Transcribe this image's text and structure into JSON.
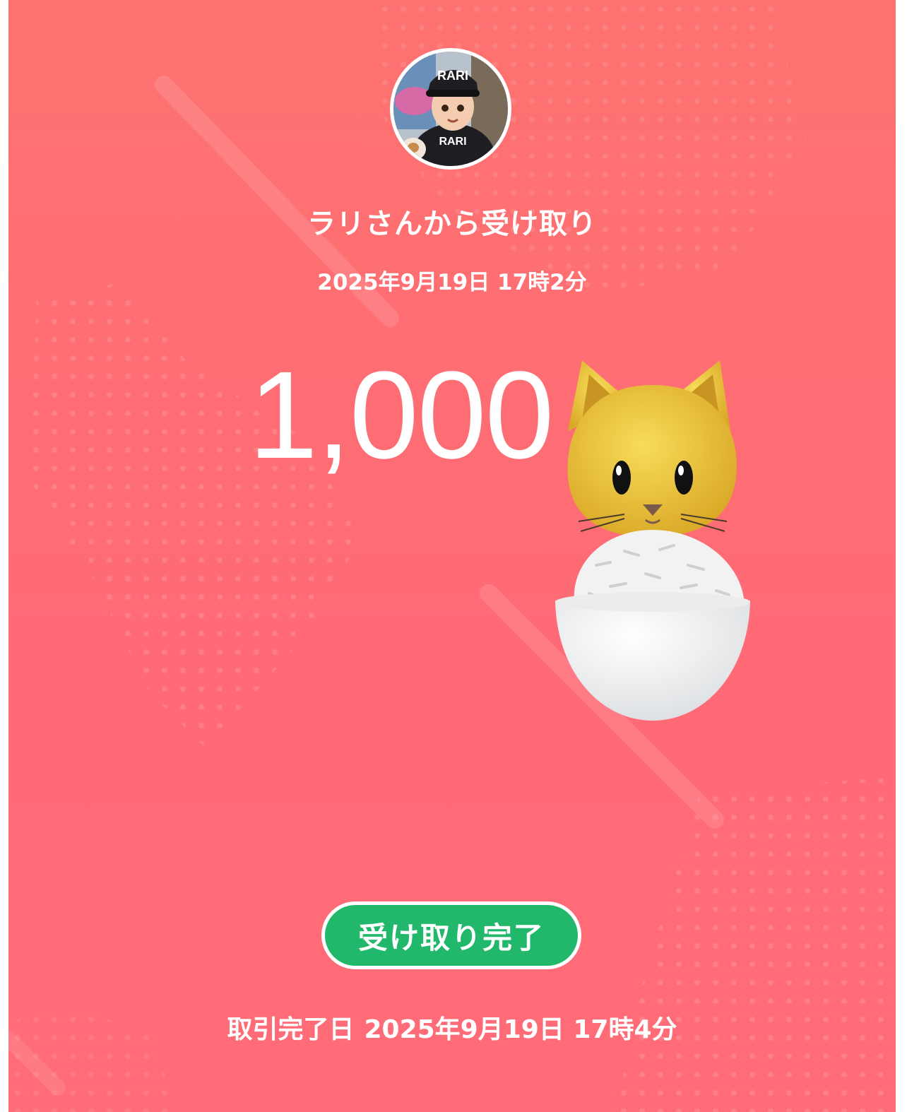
{
  "sender": {
    "avatar_label": "RARI",
    "title": "ラリさんから受け取り",
    "sent_datetime": "2025年9月19日 17時2分"
  },
  "amount": "1,000",
  "sticker": {
    "icon": "cat-rice-bowl-icon"
  },
  "status_button": {
    "label": "受け取り完了",
    "color": "#22b86b"
  },
  "completion": {
    "label": "取引完了日",
    "datetime": "2025年9月19日 17時4分"
  },
  "colors": {
    "background": "#ff6c77",
    "text": "#ffffff"
  }
}
